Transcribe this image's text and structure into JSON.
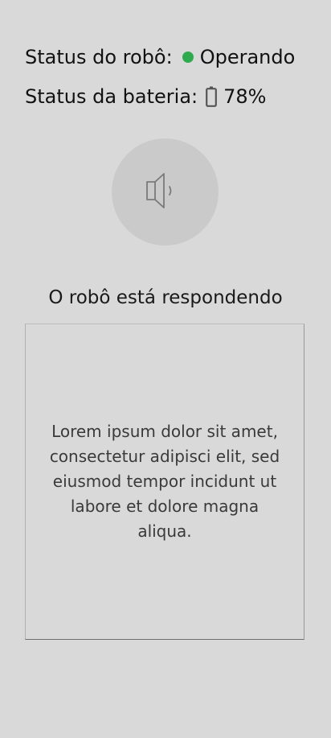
{
  "robot_status": {
    "label": "Status do robô:",
    "value": "Operando",
    "indicator_color": "#2faa4f"
  },
  "battery_status": {
    "label": "Status da bateria:",
    "value": "78%",
    "icon": "battery-icon"
  },
  "speaker": {
    "icon": "speaker-icon",
    "circle_color": "#cacaca"
  },
  "response": {
    "title": "O robô está respondendo",
    "text": "Lorem ipsum dolor sit amet, consectetur adipisci elit, sed eiusmod tempor incidunt ut labore et dolore magna aliqua."
  }
}
